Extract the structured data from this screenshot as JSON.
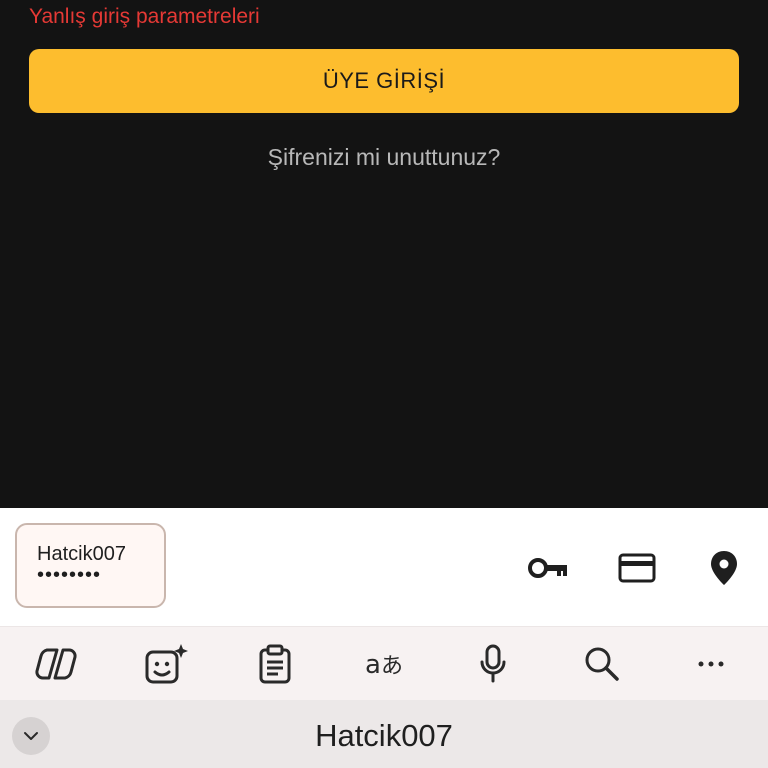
{
  "login": {
    "error_message": "Yanlış giriş parametreleri",
    "submit_label": "ÜYE GİRİŞİ",
    "forgot_password": "Şifrenizi mi unuttunuz?"
  },
  "autofill": {
    "username": "Hatcik007",
    "password_mask": "••••••••",
    "icons": [
      "key-icon",
      "credit-card-icon",
      "location-pin-icon"
    ]
  },
  "keyboard_toolbar": {
    "icons": [
      "copilot-icon",
      "sticker-sparkle-icon",
      "clipboard-icon",
      "translate-icon",
      "microphone-icon",
      "search-icon",
      "more-icon"
    ]
  },
  "suggestion": {
    "text": "Hatcik007"
  },
  "colors": {
    "background": "#131313",
    "accent": "#fdbd2e",
    "error": "#e53935"
  }
}
